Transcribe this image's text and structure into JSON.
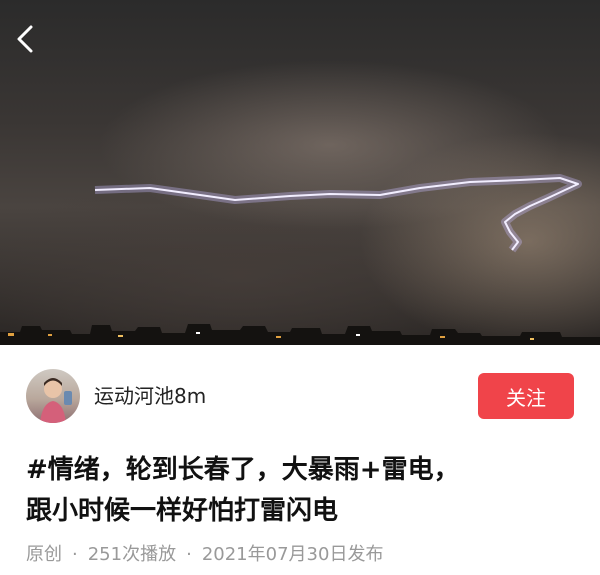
{
  "header": {
    "back_icon": "chevron-left-icon"
  },
  "author": {
    "name": "运动河池8m",
    "follow_label": "关注",
    "follow_color": "#f0444a"
  },
  "post": {
    "title_line1": "#情绪，轮到长春了，大暴雨+雷电，",
    "title_line2": "跟小时候一样好怕打雷闪电"
  },
  "meta": {
    "source": "原创",
    "separator": "·",
    "plays": "251次播放",
    "date": "2021年07月30日发布"
  }
}
